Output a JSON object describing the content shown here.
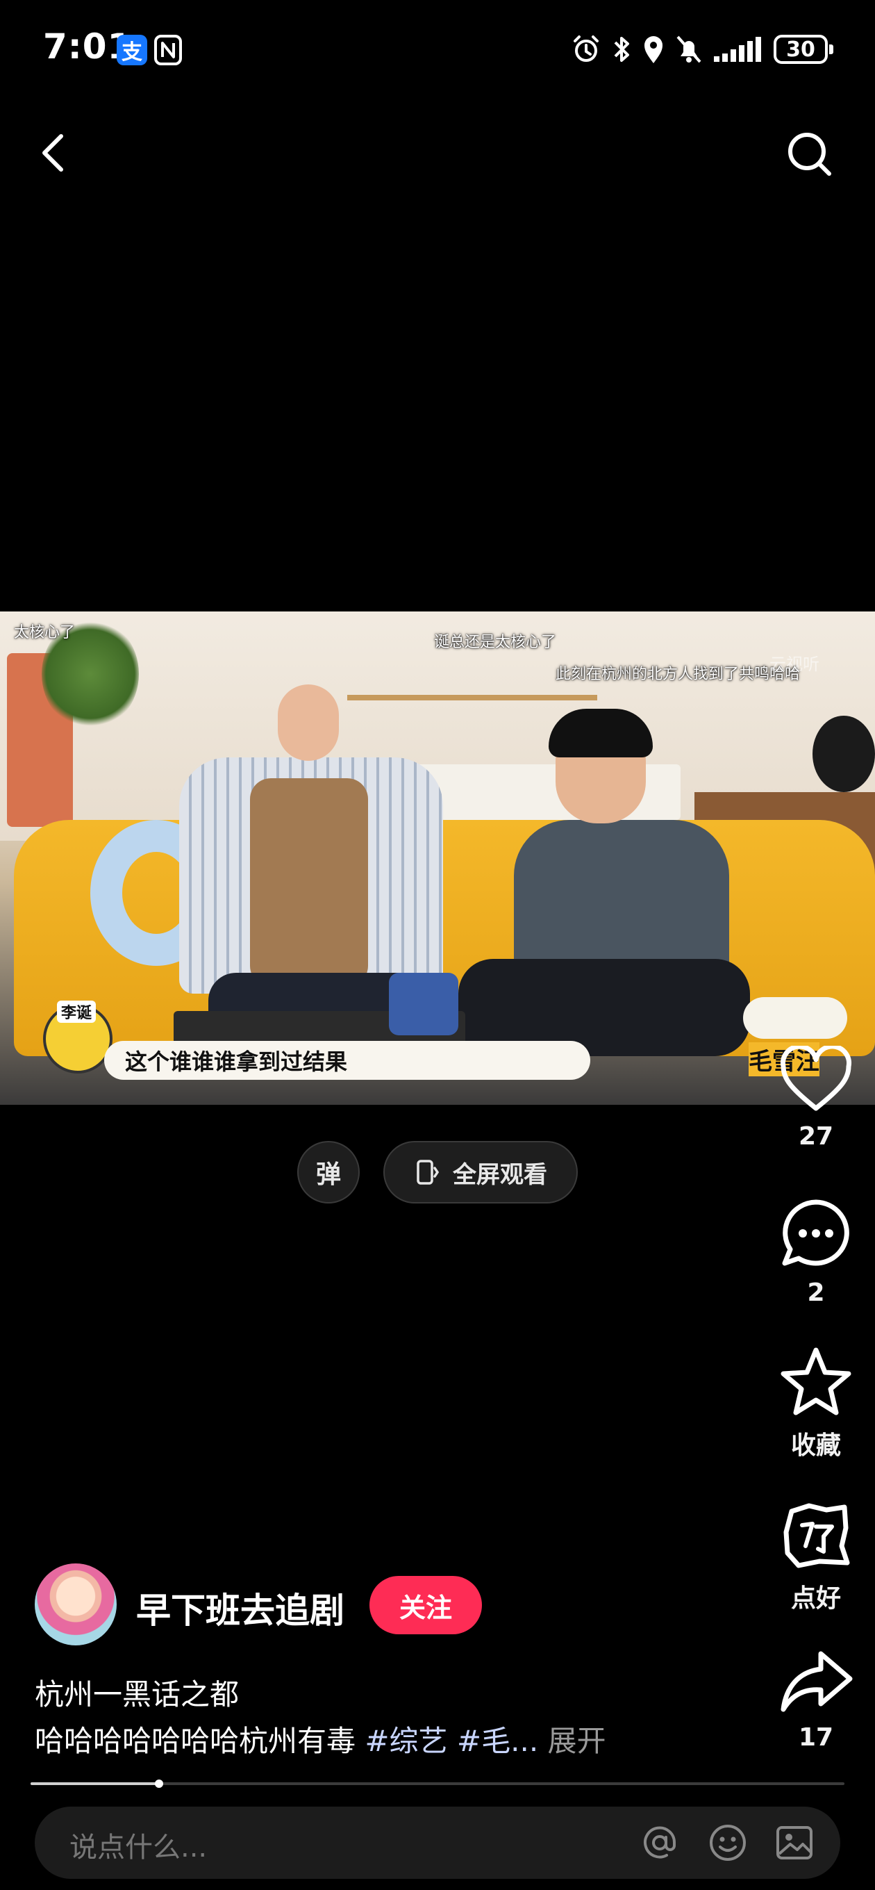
{
  "status_bar": {
    "time": "7:01",
    "alipay_glyph": "支",
    "battery": "30",
    "icons": [
      "alarm-icon",
      "bluetooth-icon",
      "location-icon",
      "mute-icon",
      "signal-icon",
      "battery-icon"
    ]
  },
  "nav": {
    "back_icon": "chevron-left-icon",
    "search_icon": "search-icon"
  },
  "video": {
    "caption_top_left": "太核心了",
    "caption_top_middle": "诞总还是太核心了",
    "caption_top_right": "此刻在杭州的北方人找到了共鸣哈哈",
    "watermark": "云视听",
    "speaker_name": "李诞",
    "subtitle": "这个谁谁谁拿到过结果",
    "show_logo": "毛雪汪"
  },
  "controls": {
    "danmaku_label": "弹",
    "fullscreen_label": "全屏观看"
  },
  "actions": {
    "likes": "27",
    "comments": "2",
    "collect_label": "收藏",
    "good_label": "点好",
    "shares": "17"
  },
  "author": {
    "name": "早下班去追剧",
    "follow_label": "关注"
  },
  "post": {
    "title": "杭州一黑话之都",
    "desc_text": "哈哈哈哈哈哈哈杭州有毒 ",
    "hashtag_1": "#综艺",
    "hashtag_2": "#毛...",
    "expand_label": "展开"
  },
  "progress": {
    "fraction": 0.158
  },
  "comment_bar": {
    "placeholder": "说点什么..."
  },
  "colors": {
    "accent": "#fe2c55",
    "background": "#000000"
  }
}
